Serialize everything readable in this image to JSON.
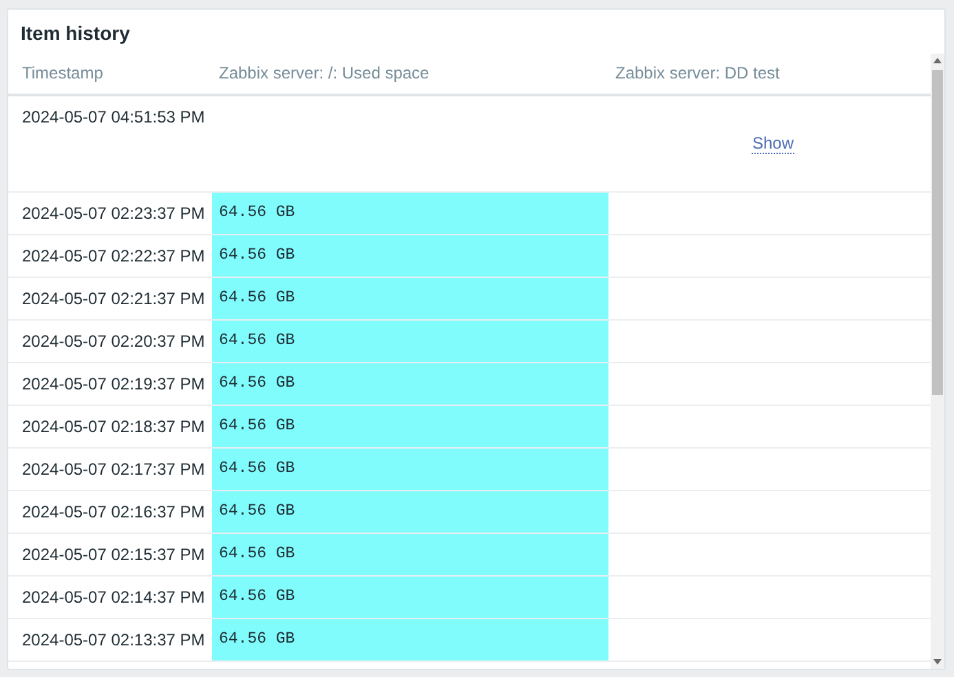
{
  "widget": {
    "title": "Item history"
  },
  "columns": [
    "Timestamp",
    "Zabbix server: /: Used space",
    "Zabbix server: DD test"
  ],
  "rows": [
    {
      "timestamp": "2024-05-07 04:51:53 PM",
      "link": "Show",
      "highlighted": false
    },
    {
      "timestamp": "2024-05-07 02:23:37 PM",
      "value": "64.56 GB",
      "highlighted": true
    },
    {
      "timestamp": "2024-05-07 02:22:37 PM",
      "value": "64.56 GB",
      "highlighted": true
    },
    {
      "timestamp": "2024-05-07 02:21:37 PM",
      "value": "64.56 GB",
      "highlighted": true
    },
    {
      "timestamp": "2024-05-07 02:20:37 PM",
      "value": "64.56 GB",
      "highlighted": true
    },
    {
      "timestamp": "2024-05-07 02:19:37 PM",
      "value": "64.56 GB",
      "highlighted": true
    },
    {
      "timestamp": "2024-05-07 02:18:37 PM",
      "value": "64.56 GB",
      "highlighted": true
    },
    {
      "timestamp": "2024-05-07 02:17:37 PM",
      "value": "64.56 GB",
      "highlighted": true
    },
    {
      "timestamp": "2024-05-07 02:16:37 PM",
      "value": "64.56 GB",
      "highlighted": true
    },
    {
      "timestamp": "2024-05-07 02:15:37 PM",
      "value": "64.56 GB",
      "highlighted": true
    },
    {
      "timestamp": "2024-05-07 02:14:37 PM",
      "value": "64.56 GB",
      "highlighted": true
    },
    {
      "timestamp": "2024-05-07 02:13:37 PM",
      "value": "64.56 GB",
      "highlighted": true
    }
  ]
}
